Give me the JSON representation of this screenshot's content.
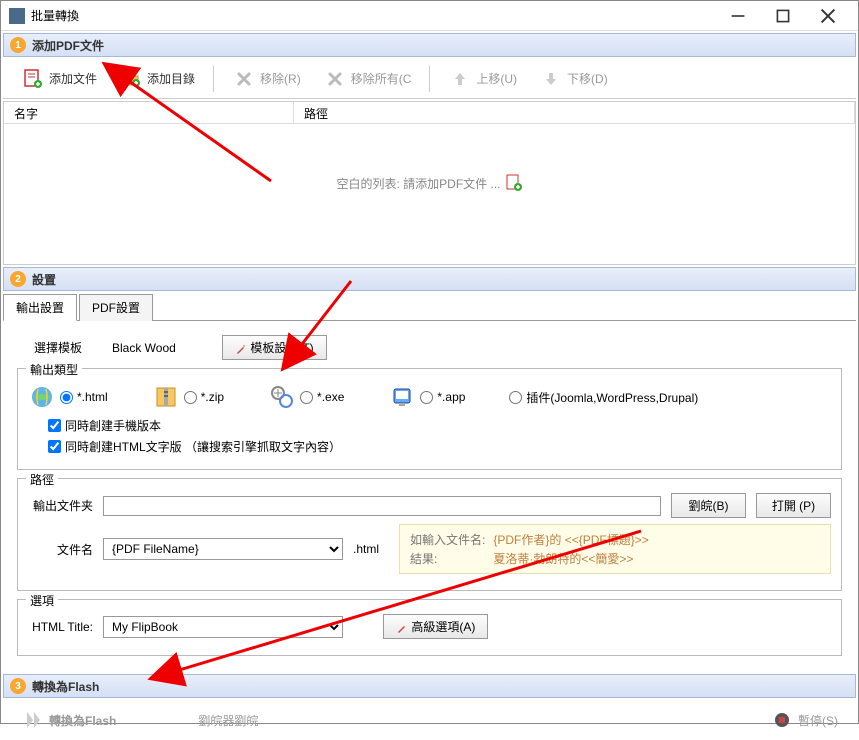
{
  "window": {
    "title": "批量轉換"
  },
  "section1": {
    "num": "1",
    "title": "添加PDF文件",
    "toolbar": {
      "add_file": "添加文件",
      "add_folder": "添加目錄",
      "remove": "移除(R)",
      "remove_all": "移除所有(C",
      "move_up": "上移(U)",
      "move_down": "下移(D)"
    },
    "list": {
      "col_name": "名字",
      "col_path": "路徑",
      "empty": "空白的列表: 請添加PDF文件 ..."
    }
  },
  "section2": {
    "num": "2",
    "title": "設置",
    "tabs": {
      "output": "輸出設置",
      "pdf": "PDF設置"
    },
    "template": {
      "label": "選擇模板",
      "value": "Black Wood",
      "btn": "模板設置(T)"
    },
    "output_type": {
      "legend": "輸出類型",
      "html": "*.html",
      "zip": "*.zip",
      "exe": "*.exe",
      "app": "*.app",
      "plugin": "插件(Joomla,WordPress,Drupal)",
      "check_mobile": "同時創建手機版本",
      "check_htmltext": "同時創建HTML文字版 （讓搜索引擎抓取文字內容）"
    },
    "path": {
      "legend": "路徑",
      "output_folder_label": "輸出文件夹",
      "output_folder_value": "",
      "browse": "劉皖(B)",
      "open": "打開 (P)",
      "filename_label": "文件名",
      "filename_value": "{PDF FileName}",
      "ext": ".html",
      "hint_input_label": "如輸入文件名:",
      "hint_input_val": "{PDF作者}的 <<{PDF標題}>>",
      "hint_result_label": "結果:",
      "hint_result_val": "夏洛蒂·勃朗特的<<簡愛>>"
    },
    "options": {
      "legend": "選項",
      "html_title_label": "HTML Title:",
      "html_title_value": "My FlipBook",
      "advanced": "高級選項(A)"
    }
  },
  "section3": {
    "num": "3",
    "title": "轉換為Flash",
    "convert": "轉換為Flash",
    "browse": "劉皖器劉皖",
    "pause": "暫停(S)"
  }
}
